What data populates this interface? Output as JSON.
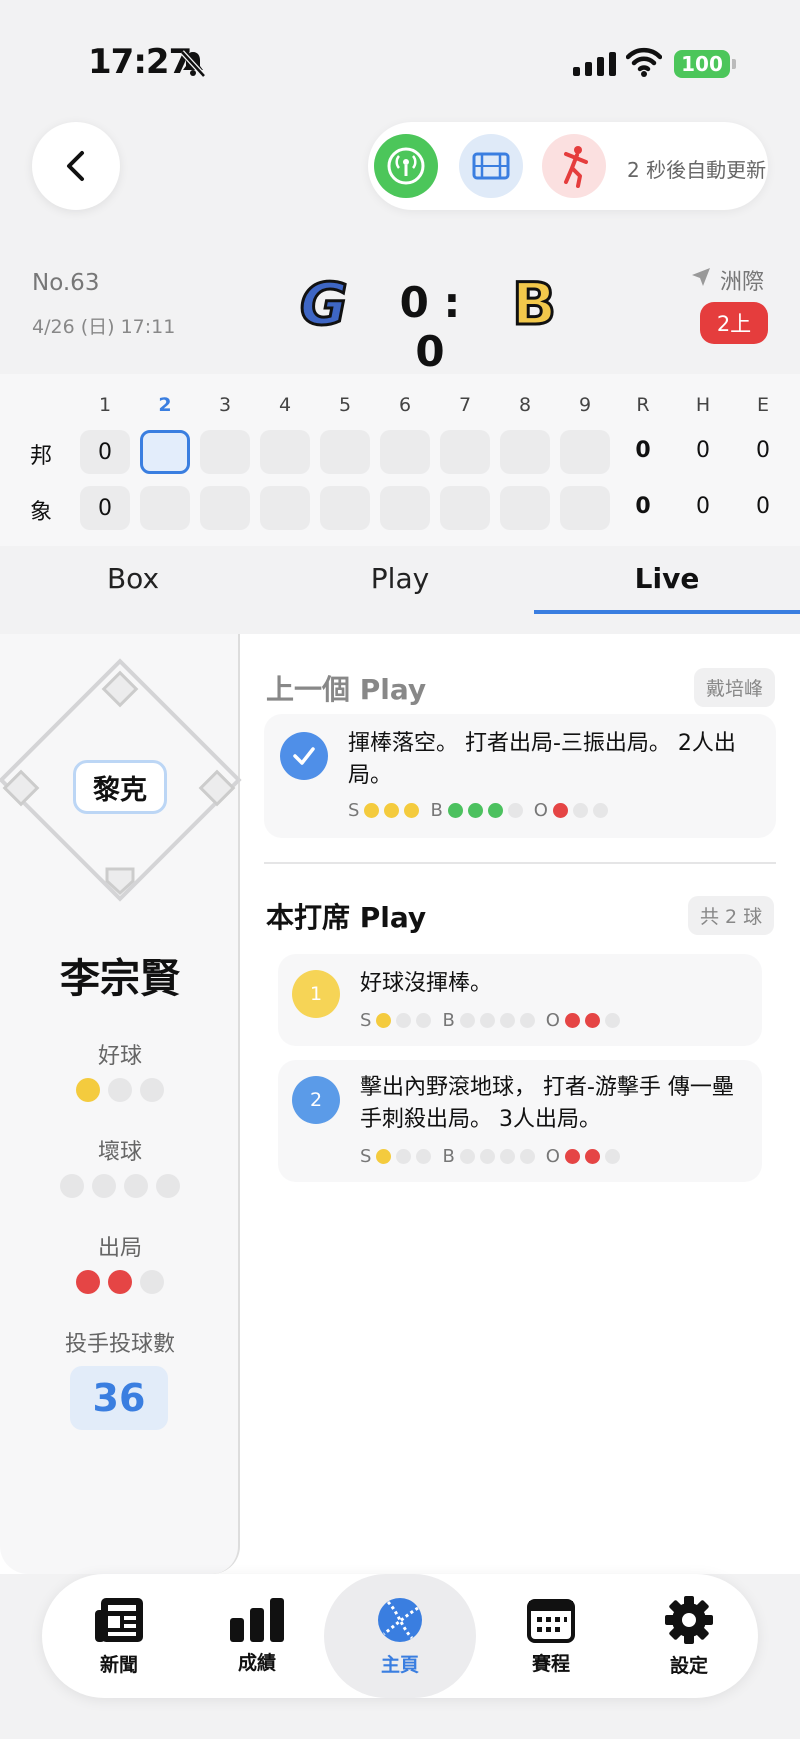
{
  "status": {
    "time": "17:27",
    "battery": "100"
  },
  "header": {
    "refresh_text": "2 秒後自動更新"
  },
  "game": {
    "number": "No.63",
    "datetime": "4/26 (日) 17:11",
    "away_logo": "G",
    "home_logo": "B",
    "score": "0 : 0",
    "venue": "洲際",
    "inning": "2上"
  },
  "linescore": {
    "headers": [
      "1",
      "2",
      "3",
      "4",
      "5",
      "6",
      "7",
      "8",
      "9",
      "R",
      "H",
      "E"
    ],
    "current_inning": "2",
    "teams": [
      {
        "name": "邦",
        "innings": [
          "0",
          "",
          "",
          "",
          "",
          "",
          "",
          "",
          ""
        ],
        "R": "0",
        "H": "0",
        "E": "0"
      },
      {
        "name": "象",
        "innings": [
          "0",
          "",
          "",
          "",
          "",
          "",
          "",
          "",
          ""
        ],
        "R": "0",
        "H": "0",
        "E": "0"
      }
    ]
  },
  "tabs": [
    "Box",
    "Play",
    "Live"
  ],
  "selected_tab": "Live",
  "field": {
    "runner": "黎克",
    "batter": "李宗賢"
  },
  "count": {
    "strike_label": "好球",
    "strikes": 1,
    "ball_label": "壞球",
    "balls": 0,
    "out_label": "出局",
    "outs": 2,
    "pitch_label": "投手投球數",
    "pitch_count": "36"
  },
  "previous_play": {
    "title": "上一個 Play",
    "pitcher": "戴培峰",
    "text": "揮棒落空。 打者出局-三振出局。 2人出局。",
    "sbo": {
      "s": 3,
      "b": 3,
      "o": 1
    }
  },
  "current_ab": {
    "title": "本打席 Play",
    "total": "共 2 球",
    "plays": [
      {
        "num": "1",
        "text": "好球沒揮棒。",
        "sbo": {
          "s": 1,
          "b": 0,
          "o": 2
        }
      },
      {
        "num": "2",
        "text": "擊出內野滾地球， 打者-游擊手 傳一壘手刺殺出局。 3人出局。",
        "sbo": {
          "s": 1,
          "b": 0,
          "o": 2
        }
      }
    ]
  },
  "sbo_labels": {
    "s": "S",
    "b": "B",
    "o": "O"
  },
  "nav": [
    "新聞",
    "成績",
    "主頁",
    "賽程",
    "設定"
  ],
  "nav_selected": "主頁",
  "colors": {
    "accent": "#3a7ee0",
    "strike": "#f4cb3e",
    "ball": "#4cc15f",
    "out": "#e54545",
    "live_green": "#4cc65a"
  }
}
